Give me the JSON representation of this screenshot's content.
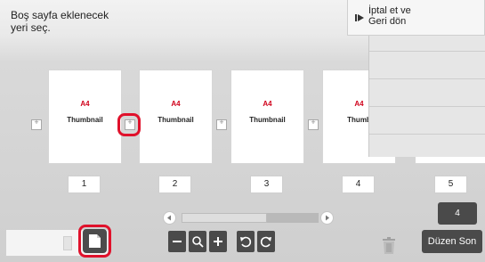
{
  "instruction": {
    "line1": "Boş sayfa eklenecek",
    "line2": "yeri seç."
  },
  "cancel_button": {
    "line1": "İptal et ve",
    "line2": "Geri dön"
  },
  "pages": [
    {
      "paper": "A4",
      "label": "Thumbnail",
      "number": "1"
    },
    {
      "paper": "A4",
      "label": "Thumbnail",
      "number": "2"
    },
    {
      "paper": "A4",
      "label": "Thumbnail",
      "number": "3"
    },
    {
      "paper": "A4",
      "label": "Thumb",
      "number": "4"
    },
    {
      "paper": "",
      "label": "",
      "number": "5"
    }
  ],
  "page_count": "4",
  "toolbar": {
    "zoom_out": "−",
    "zoom": "zoom-icon",
    "zoom_in": "+",
    "rotate_left": "rotate-ccw-icon",
    "rotate_right": "rotate-cw-icon"
  },
  "finish_button": "Düzen Son",
  "colors": {
    "accent_red": "#e0112b",
    "paper_red": "#d0021b",
    "button_dark": "#4a4a4a"
  }
}
